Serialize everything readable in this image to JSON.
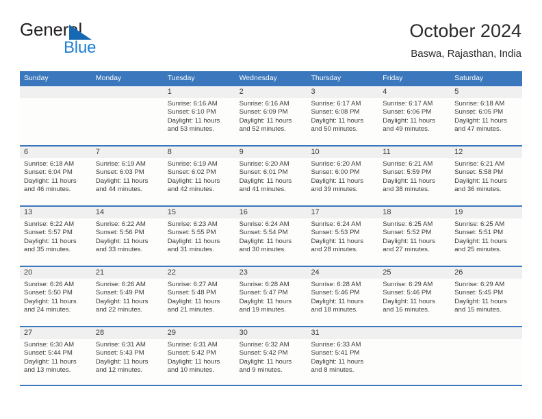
{
  "brand": {
    "word_one": "General",
    "word_two": "Blue",
    "triangle_color": "#1668b3",
    "blue_text_color": "#1e7fd4"
  },
  "header": {
    "title": "October 2024",
    "location": "Baswa, Rajasthan, India"
  },
  "theme": {
    "accent": "#3a77bc",
    "header_text": "#ffffff",
    "daynum_band": "#f0f0f0",
    "cell_background": "#fdfdfb",
    "body_text": "#3a3a3a"
  },
  "weekdays": [
    "Sunday",
    "Monday",
    "Tuesday",
    "Wednesday",
    "Thursday",
    "Friday",
    "Saturday"
  ],
  "weeks": [
    [
      {
        "day": "",
        "lines": []
      },
      {
        "day": "",
        "lines": []
      },
      {
        "day": "1",
        "lines": [
          "Sunrise: 6:16 AM",
          "Sunset: 6:10 PM",
          "Daylight: 11 hours",
          "and 53 minutes."
        ]
      },
      {
        "day": "2",
        "lines": [
          "Sunrise: 6:16 AM",
          "Sunset: 6:09 PM",
          "Daylight: 11 hours",
          "and 52 minutes."
        ]
      },
      {
        "day": "3",
        "lines": [
          "Sunrise: 6:17 AM",
          "Sunset: 6:08 PM",
          "Daylight: 11 hours",
          "and 50 minutes."
        ]
      },
      {
        "day": "4",
        "lines": [
          "Sunrise: 6:17 AM",
          "Sunset: 6:06 PM",
          "Daylight: 11 hours",
          "and 49 minutes."
        ]
      },
      {
        "day": "5",
        "lines": [
          "Sunrise: 6:18 AM",
          "Sunset: 6:05 PM",
          "Daylight: 11 hours",
          "and 47 minutes."
        ]
      }
    ],
    [
      {
        "day": "6",
        "lines": [
          "Sunrise: 6:18 AM",
          "Sunset: 6:04 PM",
          "Daylight: 11 hours",
          "and 46 minutes."
        ]
      },
      {
        "day": "7",
        "lines": [
          "Sunrise: 6:19 AM",
          "Sunset: 6:03 PM",
          "Daylight: 11 hours",
          "and 44 minutes."
        ]
      },
      {
        "day": "8",
        "lines": [
          "Sunrise: 6:19 AM",
          "Sunset: 6:02 PM",
          "Daylight: 11 hours",
          "and 42 minutes."
        ]
      },
      {
        "day": "9",
        "lines": [
          "Sunrise: 6:20 AM",
          "Sunset: 6:01 PM",
          "Daylight: 11 hours",
          "and 41 minutes."
        ]
      },
      {
        "day": "10",
        "lines": [
          "Sunrise: 6:20 AM",
          "Sunset: 6:00 PM",
          "Daylight: 11 hours",
          "and 39 minutes."
        ]
      },
      {
        "day": "11",
        "lines": [
          "Sunrise: 6:21 AM",
          "Sunset: 5:59 PM",
          "Daylight: 11 hours",
          "and 38 minutes."
        ]
      },
      {
        "day": "12",
        "lines": [
          "Sunrise: 6:21 AM",
          "Sunset: 5:58 PM",
          "Daylight: 11 hours",
          "and 36 minutes."
        ]
      }
    ],
    [
      {
        "day": "13",
        "lines": [
          "Sunrise: 6:22 AM",
          "Sunset: 5:57 PM",
          "Daylight: 11 hours",
          "and 35 minutes."
        ]
      },
      {
        "day": "14",
        "lines": [
          "Sunrise: 6:22 AM",
          "Sunset: 5:56 PM",
          "Daylight: 11 hours",
          "and 33 minutes."
        ]
      },
      {
        "day": "15",
        "lines": [
          "Sunrise: 6:23 AM",
          "Sunset: 5:55 PM",
          "Daylight: 11 hours",
          "and 31 minutes."
        ]
      },
      {
        "day": "16",
        "lines": [
          "Sunrise: 6:24 AM",
          "Sunset: 5:54 PM",
          "Daylight: 11 hours",
          "and 30 minutes."
        ]
      },
      {
        "day": "17",
        "lines": [
          "Sunrise: 6:24 AM",
          "Sunset: 5:53 PM",
          "Daylight: 11 hours",
          "and 28 minutes."
        ]
      },
      {
        "day": "18",
        "lines": [
          "Sunrise: 6:25 AM",
          "Sunset: 5:52 PM",
          "Daylight: 11 hours",
          "and 27 minutes."
        ]
      },
      {
        "day": "19",
        "lines": [
          "Sunrise: 6:25 AM",
          "Sunset: 5:51 PM",
          "Daylight: 11 hours",
          "and 25 minutes."
        ]
      }
    ],
    [
      {
        "day": "20",
        "lines": [
          "Sunrise: 6:26 AM",
          "Sunset: 5:50 PM",
          "Daylight: 11 hours",
          "and 24 minutes."
        ]
      },
      {
        "day": "21",
        "lines": [
          "Sunrise: 6:26 AM",
          "Sunset: 5:49 PM",
          "Daylight: 11 hours",
          "and 22 minutes."
        ]
      },
      {
        "day": "22",
        "lines": [
          "Sunrise: 6:27 AM",
          "Sunset: 5:48 PM",
          "Daylight: 11 hours",
          "and 21 minutes."
        ]
      },
      {
        "day": "23",
        "lines": [
          "Sunrise: 6:28 AM",
          "Sunset: 5:47 PM",
          "Daylight: 11 hours",
          "and 19 minutes."
        ]
      },
      {
        "day": "24",
        "lines": [
          "Sunrise: 6:28 AM",
          "Sunset: 5:46 PM",
          "Daylight: 11 hours",
          "and 18 minutes."
        ]
      },
      {
        "day": "25",
        "lines": [
          "Sunrise: 6:29 AM",
          "Sunset: 5:46 PM",
          "Daylight: 11 hours",
          "and 16 minutes."
        ]
      },
      {
        "day": "26",
        "lines": [
          "Sunrise: 6:29 AM",
          "Sunset: 5:45 PM",
          "Daylight: 11 hours",
          "and 15 minutes."
        ]
      }
    ],
    [
      {
        "day": "27",
        "lines": [
          "Sunrise: 6:30 AM",
          "Sunset: 5:44 PM",
          "Daylight: 11 hours",
          "and 13 minutes."
        ]
      },
      {
        "day": "28",
        "lines": [
          "Sunrise: 6:31 AM",
          "Sunset: 5:43 PM",
          "Daylight: 11 hours",
          "and 12 minutes."
        ]
      },
      {
        "day": "29",
        "lines": [
          "Sunrise: 6:31 AM",
          "Sunset: 5:42 PM",
          "Daylight: 11 hours",
          "and 10 minutes."
        ]
      },
      {
        "day": "30",
        "lines": [
          "Sunrise: 6:32 AM",
          "Sunset: 5:42 PM",
          "Daylight: 11 hours",
          "and 9 minutes."
        ]
      },
      {
        "day": "31",
        "lines": [
          "Sunrise: 6:33 AM",
          "Sunset: 5:41 PM",
          "Daylight: 11 hours",
          "and 8 minutes."
        ]
      },
      {
        "day": "",
        "lines": []
      },
      {
        "day": "",
        "lines": []
      }
    ]
  ]
}
